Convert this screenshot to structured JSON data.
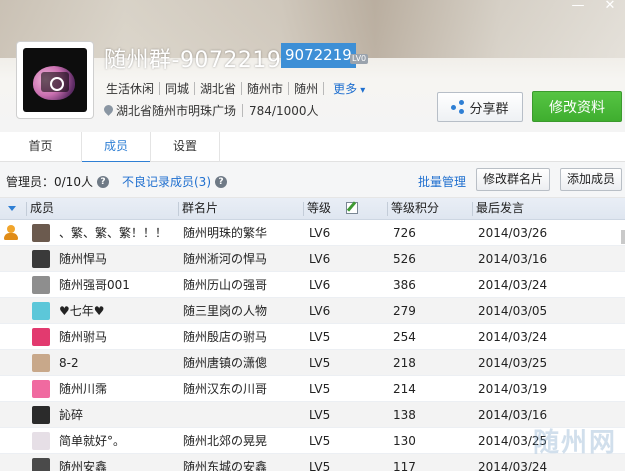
{
  "header": {
    "group_name": "随州群-9072219",
    "group_id": "9072219",
    "level_badge": "LV0",
    "tags": [
      "生活休闲",
      "同城",
      "湖北省",
      "随州市",
      "随州"
    ],
    "more_label": "更多",
    "location": "湖北省随州市明珠广场",
    "member_count": "784/1000人",
    "share_label": "分享群",
    "edit_label": "修改资料",
    "accent_color": "#3d8fd6",
    "edit_button_color": "#4cb83b"
  },
  "window_controls": [
    "—",
    "✕"
  ],
  "tabs": [
    {
      "label": "首页",
      "active": false
    },
    {
      "label": "成员",
      "active": true
    },
    {
      "label": "设置",
      "active": false
    }
  ],
  "toolbar": {
    "admins": "管理员：0/10人",
    "bad_record": "不良记录成员(3)",
    "batch": "批量管理",
    "edit_card": "修改群名片",
    "add_member": "添加成员"
  },
  "table": {
    "headers": {
      "member": "成员",
      "card": "群名片",
      "level": "等级",
      "points": "等级积分",
      "last_post": "最后发言"
    },
    "rows": [
      {
        "nick": "、繁、繁、繁！！！",
        "card": "随州明珠的繁华",
        "level": "LV6",
        "points": "726",
        "date": "2014/03/26",
        "owner": true,
        "avatar_color": "#6b5a4e"
      },
      {
        "nick": "随州悍马",
        "card": "随州淅河の悍马",
        "level": "LV6",
        "points": "526",
        "date": "2014/03/16",
        "owner": false,
        "avatar_color": "#3a3a3a"
      },
      {
        "nick": "随州强哥001",
        "card": "随州历山の强哥",
        "level": "LV6",
        "points": "386",
        "date": "2014/03/24",
        "owner": false,
        "avatar_color": "#8e8e8e"
      },
      {
        "nick": "♥七年♥",
        "card": "随三里岗の人物",
        "level": "LV6",
        "points": "279",
        "date": "2014/03/05",
        "owner": false,
        "avatar_color": "#5cc7d9"
      },
      {
        "nick": "随州驸马",
        "card": "随州殷店の驸马",
        "level": "LV5",
        "points": "254",
        "date": "2014/03/24",
        "owner": false,
        "avatar_color": "#e23a6f"
      },
      {
        "nick": "8-2",
        "card": "随州唐镇の潇傯",
        "level": "LV5",
        "points": "218",
        "date": "2014/03/25",
        "owner": false,
        "avatar_color": "#c8a88a"
      },
      {
        "nick": "随州川霈",
        "card": "随州汉东の川哥",
        "level": "LV5",
        "points": "214",
        "date": "2014/03/19",
        "owner": false,
        "avatar_color": "#f06aa0"
      },
      {
        "nick": "訫碎",
        "card": "",
        "level": "LV5",
        "points": "138",
        "date": "2014/03/16",
        "owner": false,
        "avatar_color": "#2b2b2b"
      },
      {
        "nick": "简单就好°。",
        "card": "随州北郊の晃晃",
        "level": "LV5",
        "points": "130",
        "date": "2014/03/25",
        "owner": false,
        "avatar_color": "#e6dfe6"
      },
      {
        "nick": "随州安鑫",
        "card": "随州东城の安鑫",
        "level": "LV5",
        "points": "117",
        "date": "2014/03/24",
        "owner": false,
        "avatar_color": "#4a4a4a"
      }
    ]
  }
}
